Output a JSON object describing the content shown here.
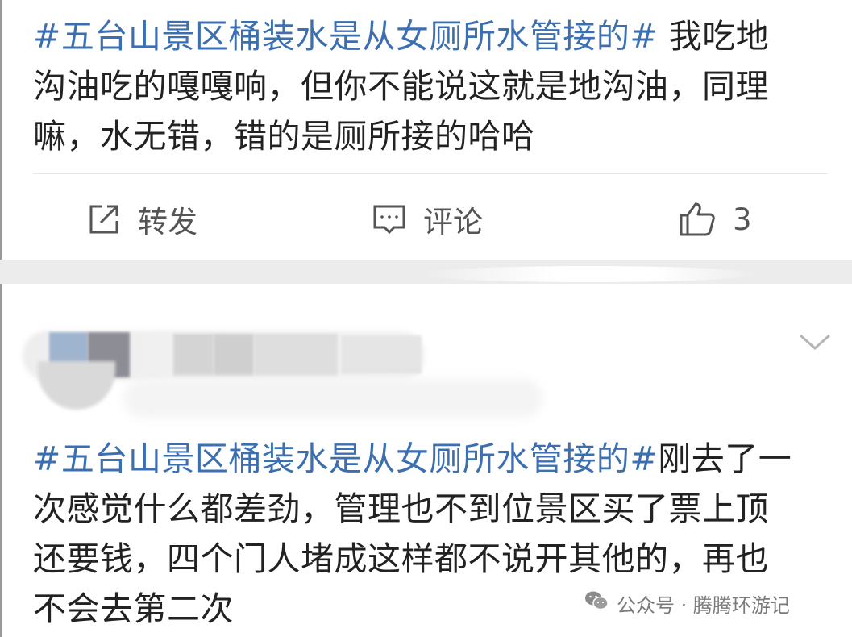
{
  "post": {
    "hashtag": "#五台山景区桶装水是从女厕所水管接的#",
    "text_line1_rest": " 我吃地",
    "text_line2": "沟油吃的嘎嘎响，但你不能说这就是地沟油，同理",
    "text_line3": "嘛，水无错，错的是厕所接的哈哈"
  },
  "actions": {
    "repost_label": "转发",
    "comment_label": "评论",
    "like_count": "3"
  },
  "comment": {
    "hashtag": "#五台山景区桶装水是从女厕所水管接的#",
    "text_line1_rest": "刚去了一",
    "text_line2": "次感觉什么都差劲，管理也不到位景区买了票上顶",
    "text_line3": "还要钱，四个门人堵成这样都不说开其他的，再也",
    "text_line4": "不会去第二次"
  },
  "watermark": {
    "text": "公众号 · 腾腾环游记",
    "icon": "wechat-icon"
  },
  "colors": {
    "hashtag": "#3b6fb1",
    "text": "#222222",
    "action": "#555555",
    "band": "#ececec"
  }
}
